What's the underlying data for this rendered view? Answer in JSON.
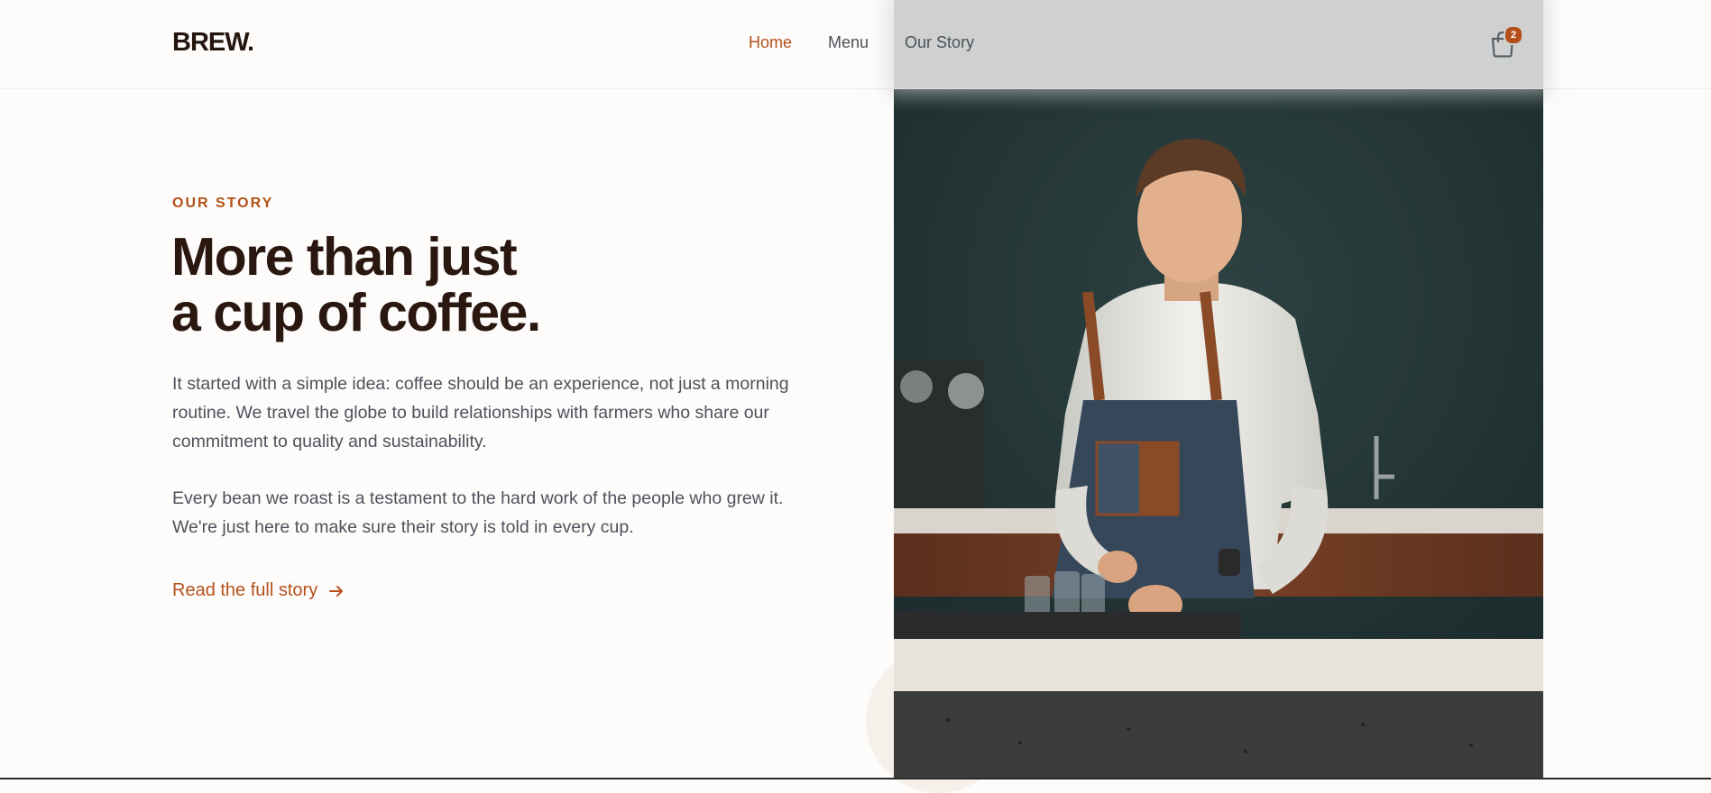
{
  "brand": {
    "logo_text": "BREW."
  },
  "nav": {
    "items": [
      {
        "label": "Home",
        "active": true
      },
      {
        "label": "Menu",
        "active": false
      },
      {
        "label": "Our Story",
        "active": false
      }
    ]
  },
  "cart": {
    "icon": "shopping-bag-icon",
    "count": "2"
  },
  "story": {
    "eyebrow": "OUR STORY",
    "headline_line1": "More than just",
    "headline_line2": "a cup of coffee.",
    "paragraph1": "It started with a simple idea: coffee should be an experience, not just a morning routine. We travel the globe to build relationships with farmers who share our commitment to quality and sustainability.",
    "paragraph2": "Every bean we roast is a testament to the hard work of the people who grew it. We're just here to make sure their story is told in every cup.",
    "cta_label": "Read the full story",
    "cta_icon": "arrow-right-icon"
  },
  "image": {
    "subject": "barista-photo"
  },
  "colors": {
    "accent": "#b5501a",
    "heading": "#2a170f",
    "body_text": "#4d525b",
    "background": "#fdfcfb"
  }
}
